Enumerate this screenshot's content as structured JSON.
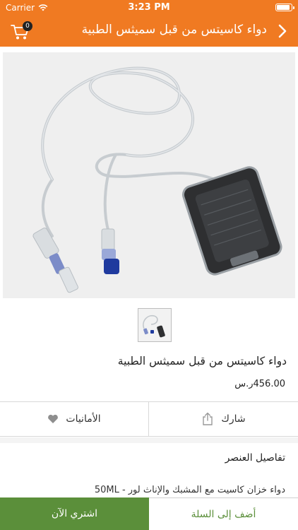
{
  "status_bar": {
    "carrier": "Carrier",
    "time": "3:23 PM",
    "battery_level": 0.95
  },
  "nav": {
    "title": "دواء كاسيتس من قبل سميثس الطبية",
    "cart_count": "0"
  },
  "product": {
    "name": "دواء كاسيتس من قبل سميثس الطبية",
    "price": "456.00ر.س"
  },
  "actions": {
    "wishlist_label": "الأمانيات",
    "share_label": "شارك"
  },
  "details": {
    "title": "تفاصيل العنصر",
    "description": "دواء خزان كاسيت مع المشبك والإناث لور - 50ML"
  },
  "bottom": {
    "buy_now_label": "اشتري الآن",
    "add_to_cart_label": "أضف إلى السلة"
  },
  "colors": {
    "accent": "#f07a22",
    "green": "#5b8f3a"
  }
}
